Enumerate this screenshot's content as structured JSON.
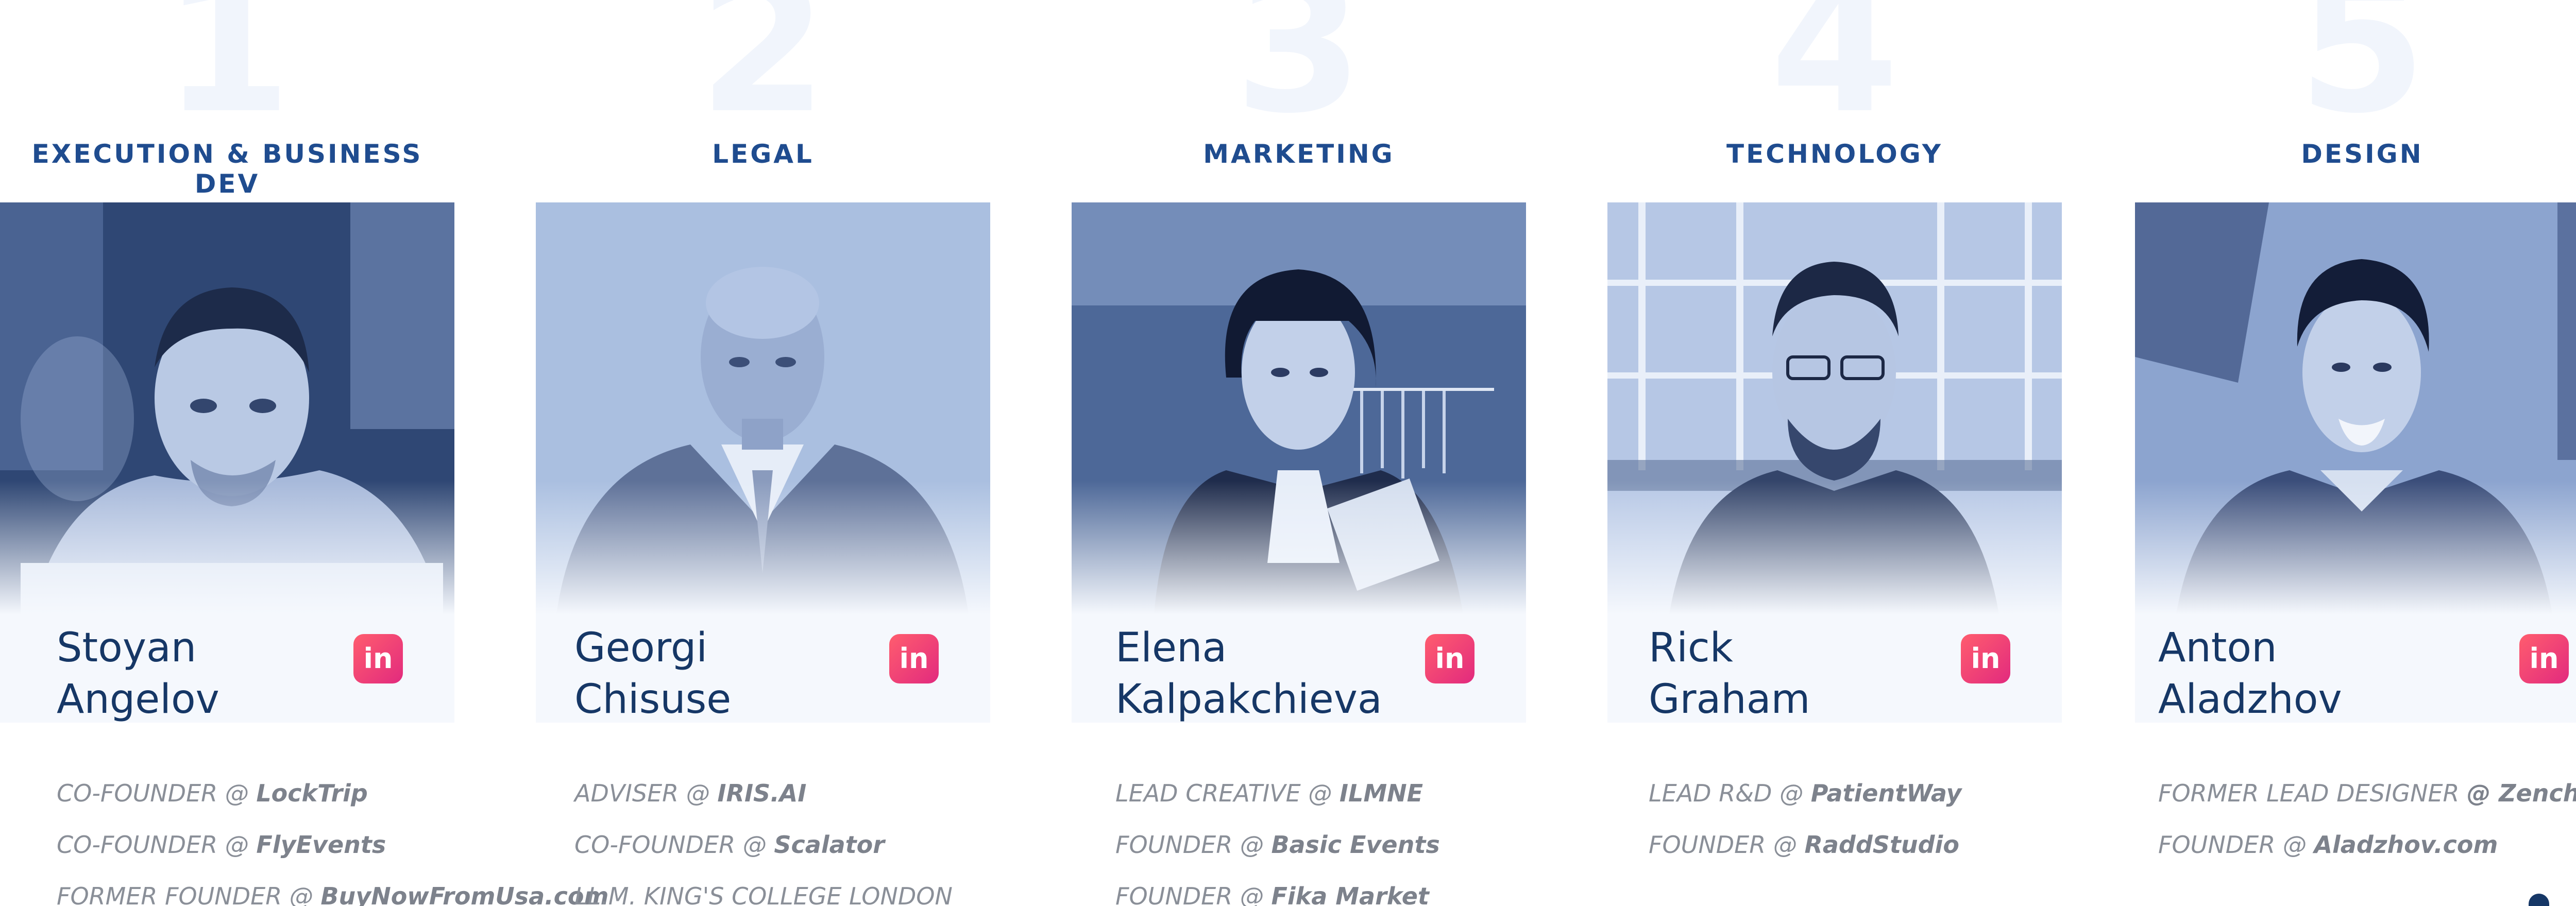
{
  "team": [
    {
      "number": "1",
      "category": "EXECUTION & BUSINESS DEV",
      "first_name": "Stoyan",
      "last_name": "Angelov",
      "linkedin_label": "in",
      "roles": [
        {
          "title": "CO-FOUNDER @ ",
          "org": "LockTrip"
        },
        {
          "title": "CO-FOUNDER @ ",
          "org": "FlyEvents"
        },
        {
          "title": "FORMER FOUNDER @ ",
          "org": "BuyNowFromUsa.com"
        }
      ]
    },
    {
      "number": "2",
      "category": "LEGAL",
      "first_name": "Georgi",
      "last_name": "Chisuse",
      "linkedin_label": "in",
      "roles": [
        {
          "title": "ADVISER @ ",
          "org": "IRIS.AI"
        },
        {
          "title": "CO-FOUNDER @ ",
          "org": "Scalator"
        },
        {
          "title": "LL.M. KING'S COLLEGE LONDON",
          "org": ""
        }
      ]
    },
    {
      "number": "3",
      "category": "MARKETING",
      "first_name": "Elena",
      "last_name": "Kalpakchieva",
      "linkedin_label": "in",
      "roles": [
        {
          "title": "LEAD CREATIVE @ ",
          "org": "ILMNE"
        },
        {
          "title": "FOUNDER @ ",
          "org": "Basic Events"
        },
        {
          "title": "FOUNDER @ ",
          "org": "Fika Market"
        }
      ]
    },
    {
      "number": "4",
      "category": "TECHNOLOGY",
      "first_name": "Rick",
      "last_name": "Graham",
      "linkedin_label": "in",
      "roles": [
        {
          "title": "LEAD R&D @ ",
          "org": "PatientWay"
        },
        {
          "title": "FOUNDER @ ",
          "org": "RaddStudio"
        }
      ]
    },
    {
      "number": "5",
      "category": "DESIGN",
      "first_name": "Anton",
      "last_name": "Aladzhov",
      "linkedin_label": "in",
      "roles": [
        {
          "title": "FORMER LEAD DESIGNER ",
          "org": "@ Zencharts"
        },
        {
          "title": "FOUNDER @ ",
          "org": "Aladzhov.com"
        }
      ]
    }
  ],
  "colors": {
    "category": "#1f4c8f",
    "name": "#163766",
    "role": "#8a8f98",
    "linkedin_start": "#ff5d6e",
    "linkedin_end": "#e22a7e",
    "number_watermark": "#f1f5fc"
  }
}
